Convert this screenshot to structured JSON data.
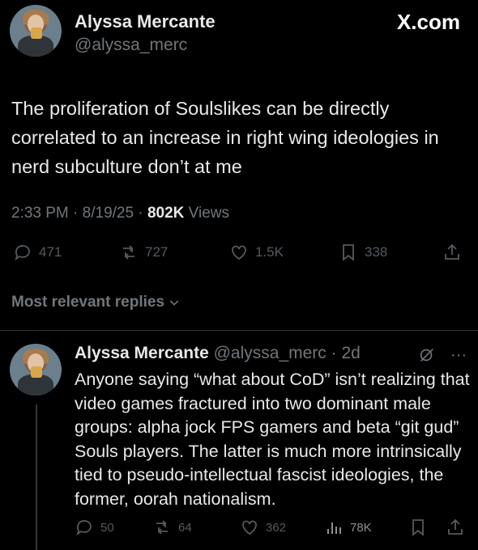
{
  "brand": {
    "label": "X.com"
  },
  "tweet": {
    "author_name": "Alyssa Mercante",
    "author_handle": "@alyssa_merc",
    "text": "The proliferation of Soulslikes can be directly correlated to an increase in right wing ideologies in nerd subculture don’t at me",
    "time": "2:33 PM",
    "date": "8/19/25",
    "views_count": "802K",
    "views_label": "Views",
    "replies": "471",
    "reposts": "727",
    "likes": "1.5K",
    "bookmarks": "338"
  },
  "replies_header": {
    "label": "Most relevant replies"
  },
  "reply": {
    "author_name": "Alyssa Mercante",
    "author_handle": "@alyssa_merc",
    "age": "2d",
    "text": "Anyone saying “what about CoD” isn’t realizing that video games fractured into two dominant male groups: alpha jock FPS gamers and beta “git gud” Souls players. The latter is much more intrinsically tied to pseudo-intellectual fascist ideologies, the former, oorah nationalism.",
    "replies": "50",
    "reposts": "64",
    "likes": "362",
    "views": "78K"
  },
  "colors": {
    "background": "#000000",
    "text": "#e7e9ea",
    "muted": "#71767b",
    "divider": "#2f3336"
  }
}
